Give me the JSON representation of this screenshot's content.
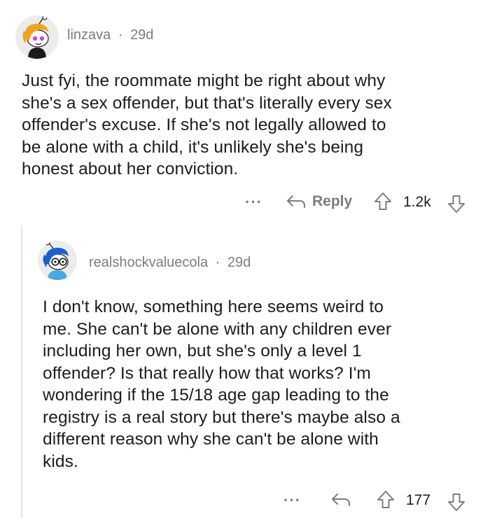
{
  "comments": [
    {
      "username": "linzava",
      "separator": "·",
      "age": "29d",
      "lines": [
        "Just fyi, the roommate might be right about why",
        "she's a sex offender, but that's literally every sex",
        "offender's excuse. If she's not legally allowed to",
        "be alone with a child, it's unlikely she's being",
        "honest about her conviction."
      ],
      "more_label": "···",
      "reply_label": "Reply",
      "upvotes": "1.2k",
      "avatar_icon": "snoo-avatar-orange-hair-icon"
    },
    {
      "username": "realshockvaluecola",
      "separator": "·",
      "age": "29d",
      "lines": [
        "I don't know, something here seems weird to",
        "me. She can't be alone with any children ever",
        "including her own, but she's only a level 1",
        "offender? Is that really how that works? I'm",
        "wondering if the 15/18 age gap leading to the",
        "registry is a real story but there's maybe also a",
        "different reason why she can't be alone with",
        "kids."
      ],
      "more_label": "···",
      "upvotes": "177",
      "avatar_icon": "snoo-avatar-blue-hair-glasses-icon"
    }
  ],
  "colors": {
    "text": "#1c1c1c",
    "meta": "#7c7c7c",
    "thread_line": "#e4e4e4"
  }
}
